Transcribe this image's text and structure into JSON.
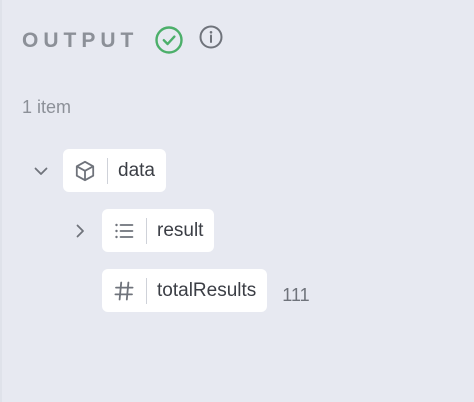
{
  "panel": {
    "title": "OUTPUT",
    "item_count": "1 item"
  },
  "tree": {
    "root": {
      "label": "data",
      "icon": "cube-icon",
      "expanded": true
    },
    "children": [
      {
        "label": "result",
        "icon": "list-icon",
        "expanded": false
      },
      {
        "label": "totalResults",
        "icon": "hash-icon",
        "value": "111"
      }
    ]
  },
  "colors": {
    "background": "#e7e9f1",
    "success": "#4caf6a",
    "muted_text": "#8c9098",
    "chip_bg": "#ffffff"
  }
}
